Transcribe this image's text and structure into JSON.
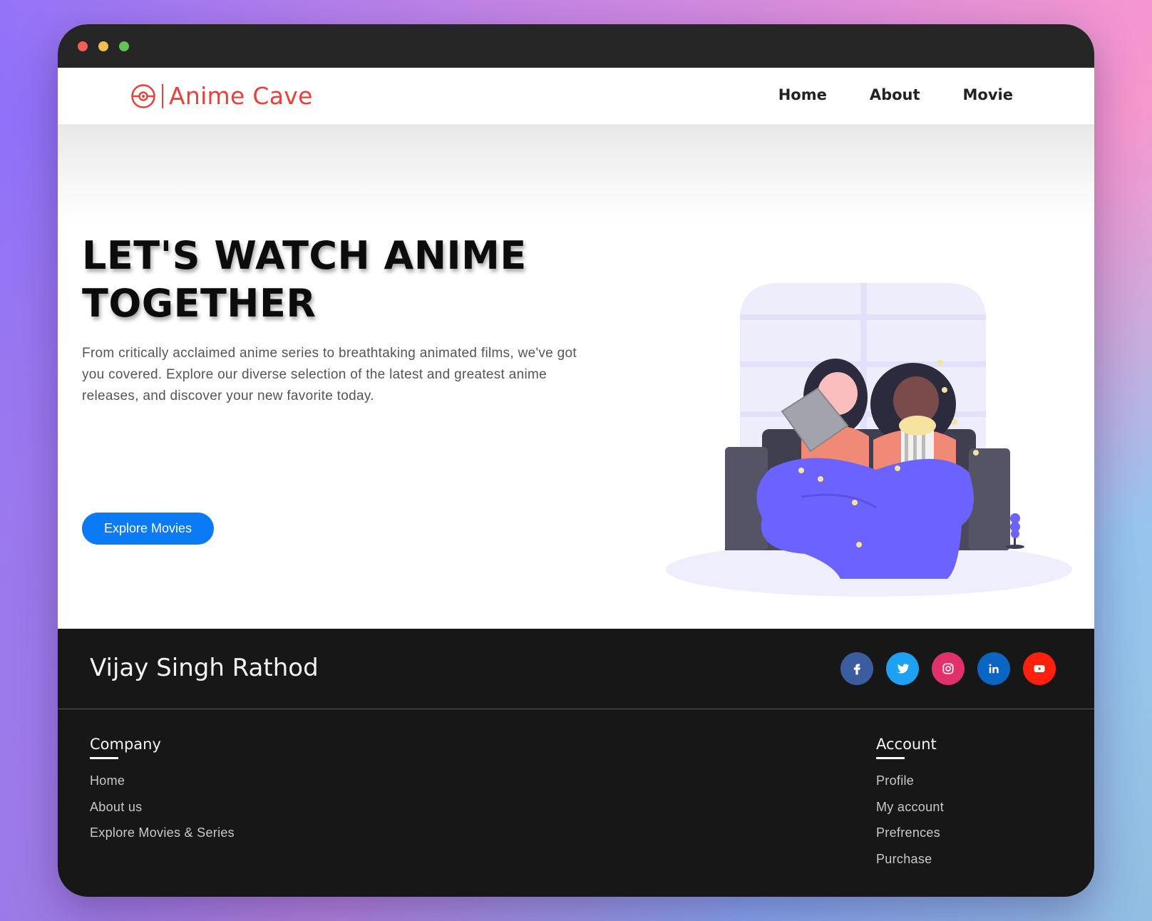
{
  "brand": {
    "name": "Anime Cave",
    "color": "#e8413c",
    "icon": "pokeball-icon"
  },
  "nav": {
    "items": [
      {
        "label": "Home"
      },
      {
        "label": "About"
      },
      {
        "label": "Movie"
      }
    ]
  },
  "hero": {
    "title_line1": "LET'S WATCH ANIME",
    "title_line2": "TOGETHER",
    "description": "From critically acclaimed anime series to breathtaking animated films, we've got you covered. Explore our diverse selection of the latest and greatest anime releases, and discover your new favorite today.",
    "button_label": "Explore Movies",
    "button_color": "#0b7bf5",
    "illustration": "two-people-watching-on-couch-illustration"
  },
  "footer": {
    "name": "Vijay Singh Rathod",
    "socials": [
      {
        "icon": "facebook-icon",
        "color": "#3b5da0"
      },
      {
        "icon": "twitter-icon",
        "color": "#1da1f2"
      },
      {
        "icon": "instagram-icon",
        "color": "#e1306c"
      },
      {
        "icon": "linkedin-icon",
        "color": "#0a66c2"
      },
      {
        "icon": "youtube-icon",
        "color": "#ff1f0f"
      }
    ],
    "company": {
      "title": "Company",
      "links": [
        "Home",
        "About us",
        "Explore Movies & Series"
      ]
    },
    "account": {
      "title": "Account",
      "links": [
        "Profile",
        "My account",
        "Prefrences",
        "Purchase"
      ]
    }
  }
}
